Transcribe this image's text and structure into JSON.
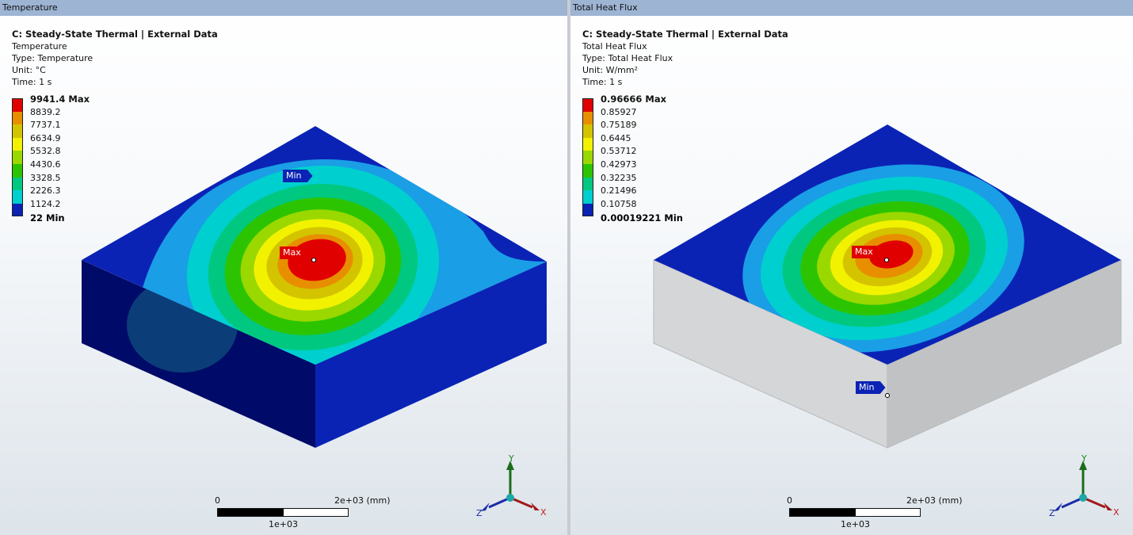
{
  "left": {
    "title": "Temperature",
    "info": {
      "header": "C: Steady-State Thermal | External Data",
      "name": "Temperature",
      "type": "Type: Temperature",
      "unit": "Unit: °C",
      "time": "Time: 1 s"
    },
    "legend": {
      "labels": [
        "9941.4 Max",
        "8839.2",
        "7737.1",
        "6634.9",
        "5532.8",
        "4430.6",
        "3328.5",
        "2226.3",
        "1124.2",
        "22 Min"
      ]
    },
    "probe_max": "Max",
    "probe_min": "Min",
    "scale": {
      "start": "0",
      "end": "2e+03 (mm)",
      "mid": "1e+03"
    },
    "triad": {
      "y": "Y",
      "x": "X",
      "z": "Z"
    }
  },
  "right": {
    "title": "Total Heat Flux",
    "info": {
      "header": "C: Steady-State Thermal | External Data",
      "name": "Total Heat Flux",
      "type": "Type: Total Heat Flux",
      "unit": "Unit: W/mm²",
      "time": "Time: 1 s"
    },
    "legend": {
      "labels": [
        "0.96666 Max",
        "0.85927",
        "0.75189",
        "0.6445",
        "0.53712",
        "0.42973",
        "0.32235",
        "0.21496",
        "0.10758",
        "0.00019221 Min"
      ]
    },
    "probe_max": "Max",
    "probe_min": "Min",
    "scale": {
      "start": "0",
      "end": "2e+03 (mm)",
      "mid": "1e+03"
    },
    "triad": {
      "y": "Y",
      "x": "X",
      "z": "Z"
    }
  },
  "colors": {
    "band_red": "#e00000",
    "band_orange": "#e88f00",
    "band_yellow_orange": "#d4c400",
    "band_yellow": "#f2f200",
    "band_yellow_green": "#9ad800",
    "band_green": "#2cc400",
    "band_green_cyan": "#00c880",
    "band_cyan": "#00cfcf",
    "band_light_blue": "#1a9ee6",
    "band_blue": "#0a23b5",
    "side_dark_blue": "#000a68",
    "side_gray": "#c9cbcd"
  }
}
